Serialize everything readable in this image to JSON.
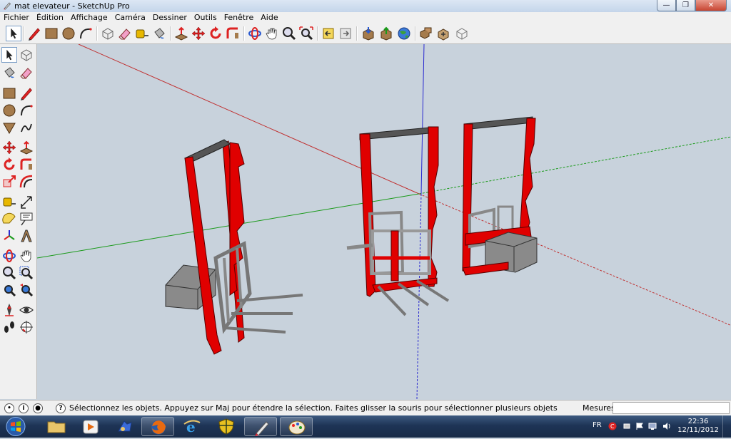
{
  "window": {
    "title": "mat elevateur - SketchUp Pro",
    "minimize_icon": "minimize-icon",
    "maximize_icon": "restore-icon",
    "close_icon": "close-icon"
  },
  "menu": [
    "Fichier",
    "Édition",
    "Affichage",
    "Caméra",
    "Dessiner",
    "Outils",
    "Fenêtre",
    "Aide"
  ],
  "toolbar": {
    "tools": [
      "select",
      "line",
      "rectangle",
      "circle",
      "arc",
      "make-component",
      "eraser",
      "tape-measure",
      "paint-bucket",
      "push-pull",
      "move",
      "rotate",
      "follow-me",
      "orbit",
      "pan",
      "zoom",
      "zoom-extents",
      "previous-view",
      "next-view",
      "get-models",
      "share-model",
      "share-component",
      "add-location",
      "toggle-terrain",
      "3d-warehouse",
      "extension-warehouse",
      "components"
    ]
  },
  "left_toolbar": {
    "tools": [
      "select",
      "make-component",
      "paint-bucket",
      "eraser",
      "rectangle",
      "line",
      "circle",
      "arc",
      "polygon",
      "freehand",
      "move",
      "push-pull",
      "rotate",
      "follow-me",
      "scale",
      "offset",
      "tape-measure",
      "dimension",
      "protractor",
      "text",
      "axes",
      "3d-text",
      "orbit",
      "pan",
      "zoom",
      "zoom-window",
      "zoom-extents",
      "previous",
      "position-camera",
      "look-around",
      "walk",
      "section-plane"
    ]
  },
  "colors": {
    "frame_red": "#e00000",
    "axis_red": "#c03030",
    "axis_green": "#1a9a1a",
    "axis_blue": "#2a2ad0",
    "background": "#c8d2dc"
  },
  "status": {
    "message": "Sélectionnez les objets. Appuyez sur Maj pour étendre la sélection. Faites glisser la souris pour sélectionner plusieurs objets",
    "measures_label": "Mesures",
    "measures_value": ""
  },
  "taskbar": {
    "items": [
      "start-orb",
      "windows-explorer",
      "media-player",
      "program-icon",
      "firefox",
      "internet-explorer",
      "shield-app",
      "sketchup-pro",
      "paint-app"
    ],
    "language": "FR",
    "time": "22:36",
    "date": "12/11/2012"
  }
}
